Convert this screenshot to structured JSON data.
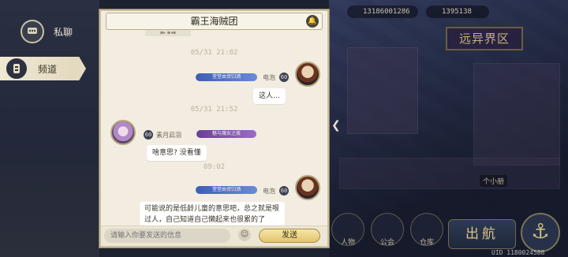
{
  "left_nav": {
    "private_chat_label": "私聊",
    "channel_label": "频道"
  },
  "chat": {
    "title": "霸王海贼团",
    "top_partial_tag": "▪▸ ▪◂▪",
    "timestamps": [
      "05/31 21:02",
      "05/31 21:52",
      "09:02"
    ],
    "messages": [
      {
        "sender": "电泡",
        "level": "60",
        "tag": "堂堂由贸归洒",
        "text": "这人…",
        "side": "right"
      },
      {
        "sender": "素月凪羽",
        "level": "60",
        "tag": "魅与魔女之夜",
        "text": "啥意思? 没看懂",
        "side": "left"
      },
      {
        "sender": "电泡",
        "level": "60",
        "tag": "堂堂由贸归洒",
        "text": "可能说的是低龄儿童的意思吧，总之就是哏过人，自己知道自己懒起来也很累的了",
        "side": "right"
      }
    ],
    "input_placeholder": "请输入你要发送的信息",
    "send_label": "发送",
    "emoji_icon": "☺"
  },
  "scene": {
    "resource_left": "13186001286",
    "resource_right": "1395138",
    "sign_text": "远异界区",
    "sortie_label": "出航",
    "btn_label_1": "个小册",
    "btn_label_2": "公会",
    "btn_label_3": "仓库",
    "btn_label_4": "人物",
    "uid_text": "UID 1180024588"
  }
}
